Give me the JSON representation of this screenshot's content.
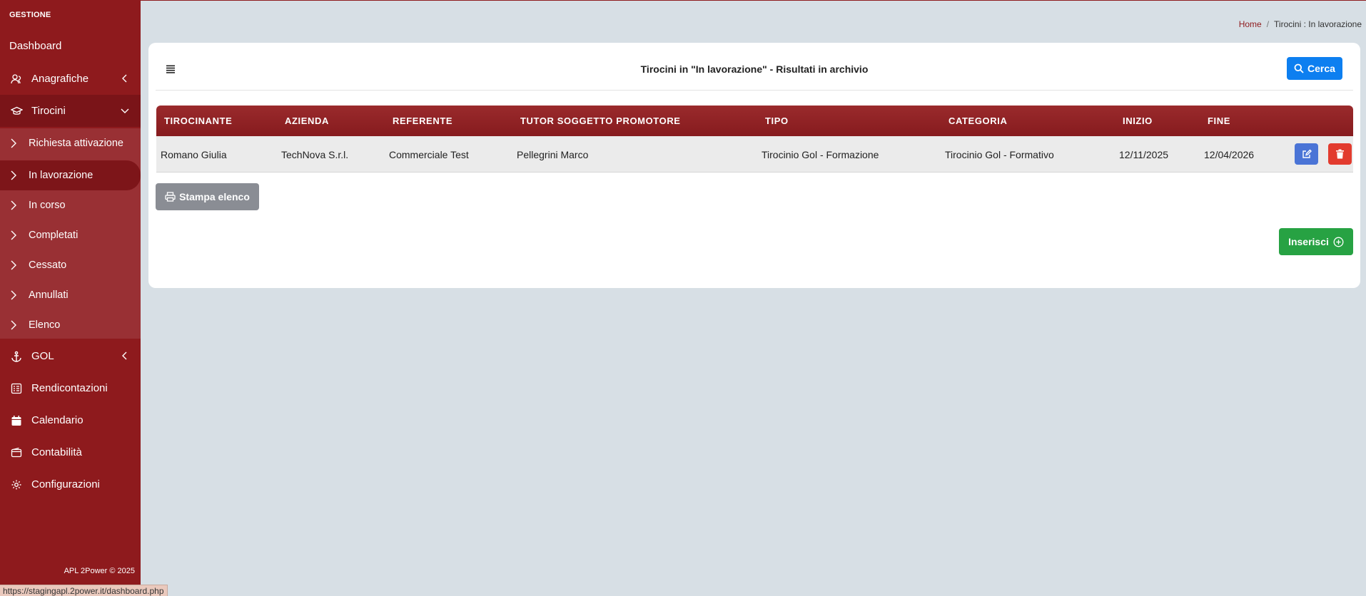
{
  "sidebar": {
    "heading": "GESTIONE",
    "items": [
      {
        "label": "Dashboard",
        "icon": "none"
      },
      {
        "label": "Anagrafiche",
        "icon": "users-icon"
      },
      {
        "label": "Tirocini",
        "icon": "graduation-cap-icon"
      },
      {
        "label": "GOL",
        "icon": "anchor-icon"
      },
      {
        "label": "Rendicontazioni",
        "icon": "list-icon"
      },
      {
        "label": "Calendario",
        "icon": "calendar-icon"
      },
      {
        "label": "Contabilità",
        "icon": "wallet-icon"
      },
      {
        "label": "Configurazioni",
        "icon": "gear-icon"
      }
    ],
    "submenu": [
      {
        "label": "Richiesta attivazione"
      },
      {
        "label": "In lavorazione",
        "active": true
      },
      {
        "label": "In corso"
      },
      {
        "label": "Completati"
      },
      {
        "label": "Cessato"
      },
      {
        "label": "Annullati"
      },
      {
        "label": "Elenco"
      }
    ],
    "footer": "APL 2Power © 2025"
  },
  "breadcrumb": {
    "home": "Home",
    "separator": "/",
    "current": "Tirocini : In lavorazione"
  },
  "card": {
    "title": "Tirocini in \"In lavorazione\" - Risultati in archivio",
    "search_button": "Cerca"
  },
  "table": {
    "columns": [
      "TIROCINANTE",
      "AZIENDA",
      "REFERENTE",
      "TUTOR SOGGETTO PROMOTORE",
      "TIPO",
      "CATEGORIA",
      "INIZIO",
      "FINE"
    ],
    "rows": [
      [
        "Romano Giulia",
        "TechNova S.r.l.",
        "Commerciale Test",
        "Pellegrini Marco",
        "Tirocinio Gol - Formazione",
        "Tirocinio Gol - Formativo",
        "12/11/2025",
        "12/04/2026"
      ]
    ]
  },
  "buttons": {
    "print": "Stampa elenco",
    "insert": "Inserisci"
  },
  "status_url": "https://stagingapl.2power.it/dashboard.php",
  "colors": {
    "sidebar": "#8e1a1d",
    "header_row": "#8e1a1d",
    "primary": "#0d7ff0",
    "edit": "#4a74d6",
    "delete": "#e23b2e",
    "insert": "#27a243",
    "print": "#8a8d94",
    "background": "#d7dfe5"
  }
}
